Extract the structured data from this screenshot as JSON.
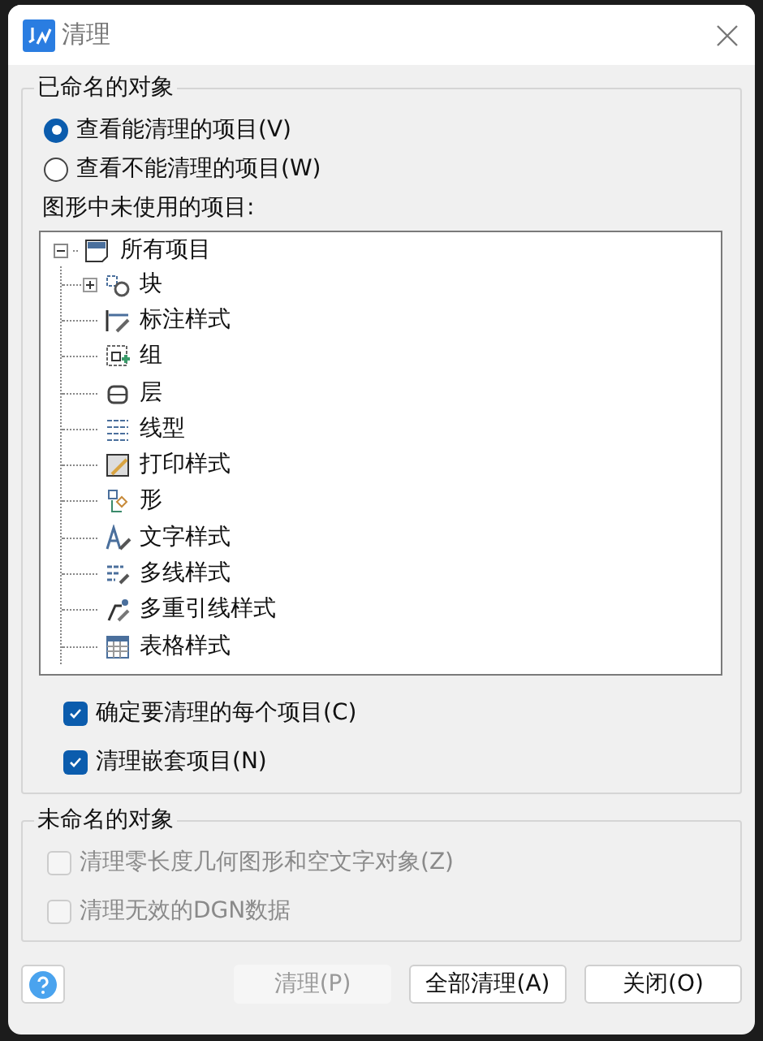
{
  "window": {
    "title": "清理"
  },
  "named_objects": {
    "title": "已命名的对象",
    "view_options": [
      {
        "label": "查看能清理的项目(V)",
        "selected": true
      },
      {
        "label": "查看不能清理的项目(W)",
        "selected": false
      }
    ],
    "tree_label": "图形中未使用的项目:",
    "tree": {
      "label": "所有项目",
      "expanded": true,
      "children": [
        {
          "label": "块",
          "expanded": false
        },
        {
          "label": "标注样式"
        },
        {
          "label": "组"
        },
        {
          "label": "层"
        },
        {
          "label": "线型"
        },
        {
          "label": "打印样式"
        },
        {
          "label": "形"
        },
        {
          "label": "文字样式"
        },
        {
          "label": "多线样式"
        },
        {
          "label": "多重引线样式"
        },
        {
          "label": "表格样式"
        }
      ]
    },
    "options": [
      {
        "label": "确定要清理的每个项目(C)",
        "checked": true,
        "disabled": false
      },
      {
        "label": "清理嵌套项目(N)",
        "checked": true,
        "disabled": false
      }
    ]
  },
  "unnamed_objects": {
    "title": "未命名的对象",
    "options": [
      {
        "label": "清理零长度几何图形和空文字对象(Z)",
        "checked": false,
        "disabled": true
      },
      {
        "label": "清理无效的DGN数据",
        "checked": false,
        "disabled": true
      }
    ]
  },
  "buttons": [
    {
      "label": "清理(P)",
      "disabled": true
    },
    {
      "label": "全部清理(A)",
      "disabled": false
    },
    {
      "label": "关闭(O)",
      "disabled": false
    }
  ]
}
